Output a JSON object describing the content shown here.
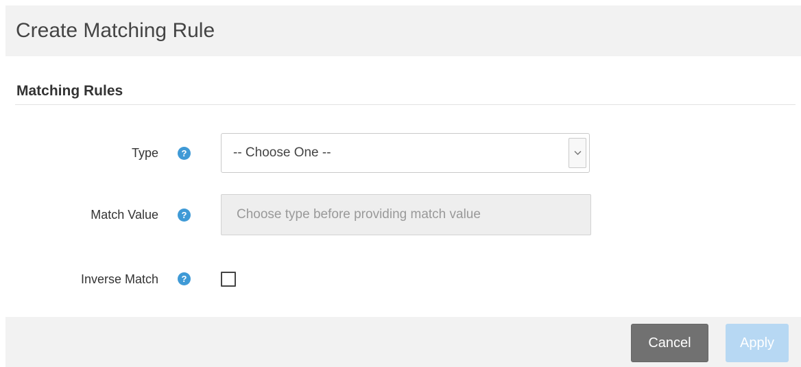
{
  "dialog": {
    "title": "Create Matching Rule"
  },
  "section": {
    "title": "Matching Rules"
  },
  "form": {
    "type": {
      "label": "Type",
      "selected_value": "-- Choose One --"
    },
    "match_value": {
      "label": "Match Value",
      "value": "",
      "placeholder": "Choose type before providing match value",
      "disabled": true
    },
    "inverse_match": {
      "label": "Inverse Match",
      "checked": false
    },
    "help_icon_glyph": "?"
  },
  "footer": {
    "cancel_label": "Cancel",
    "apply_label": "Apply"
  },
  "colors": {
    "help_icon": "#3f9ad6",
    "cancel_button": "#717171",
    "apply_button_disabled": "#b7d8f3",
    "panel_background": "#f2f2f2"
  },
  "icons": {
    "help": "question-circle-icon",
    "dropdown": "chevron-down-icon"
  }
}
